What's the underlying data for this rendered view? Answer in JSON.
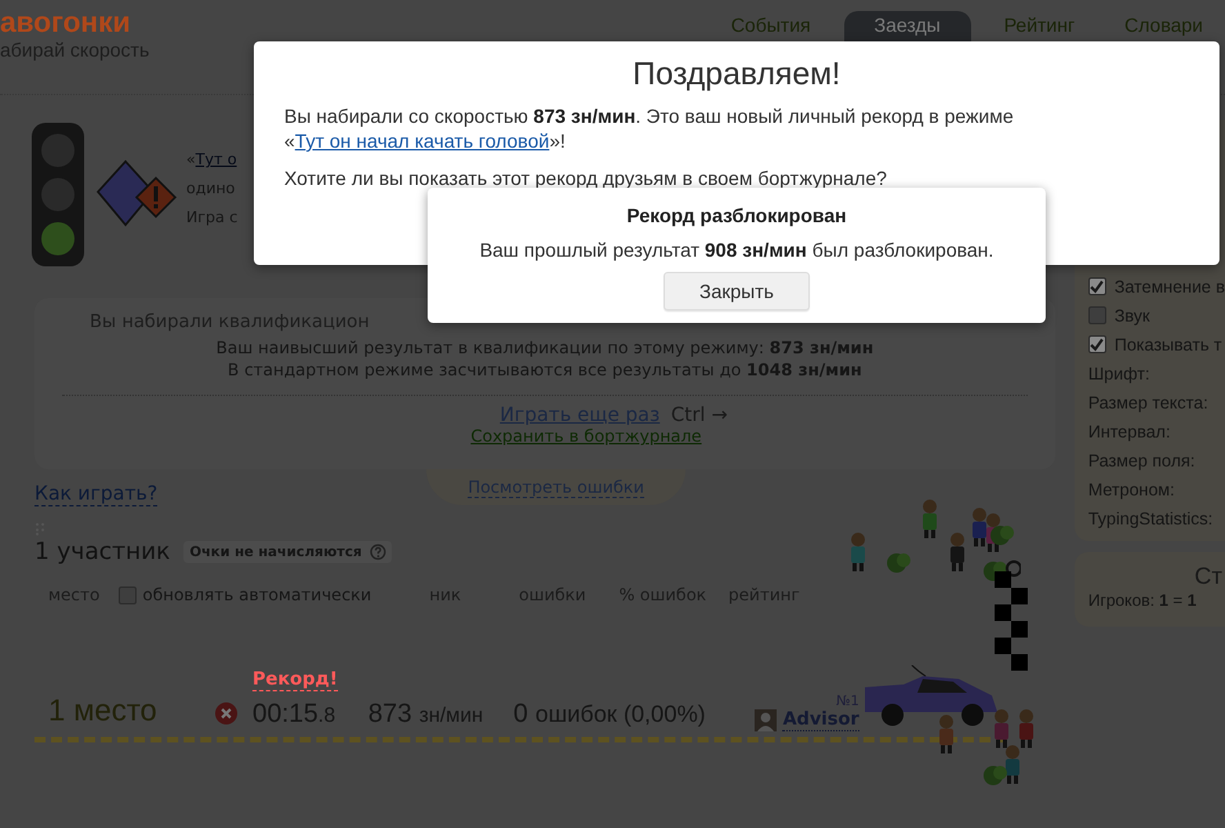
{
  "header": {
    "logo": "авогонки",
    "slogan": "абирай скорость",
    "tabs": [
      {
        "label": "События",
        "selected": false
      },
      {
        "label": "Заезды",
        "selected": true
      },
      {
        "label": "Рейтинг",
        "selected": false
      },
      {
        "label": "Словари",
        "selected": false
      }
    ]
  },
  "game_info": {
    "quote": "«",
    "mode_link": "Тут о",
    "line_2": "одино",
    "line_3": "Игра с"
  },
  "result_panel": {
    "title": "Вы набирали квалификацион",
    "lines": [
      "Ваш наивысший результат в квалификации по этому режиму: **873 зн/мин**",
      "В стандартном режиме засчитываются все результаты до **1048 зн/мин**"
    ],
    "play_again": "Играть еще раз",
    "shortcut": "Ctrl →",
    "save_link": "Сохранить в бортжурнале"
  },
  "how_to_play": "Как играть?",
  "errors_tab": "Посмотреть ошибки",
  "participants": {
    "title": "1 участник",
    "badge": "Очки не начисляются",
    "columns": [
      {
        "kind": "text",
        "label": "место"
      },
      {
        "kind": "checkbox",
        "label": "обновлять автоматически",
        "checked": false
      },
      {
        "kind": "text",
        "label": "ник"
      },
      {
        "kind": "text",
        "label": "ошибки"
      },
      {
        "kind": "text",
        "label": "% ошибок"
      },
      {
        "kind": "text",
        "label": "рейтинг"
      }
    ],
    "rows": [
      {
        "record": "Рекорд!",
        "place": "1 место",
        "time": "00:15.8",
        "speed": "873",
        "speed_unit": "зн/мин",
        "errors": "0",
        "errors_text": "ошибок (0,00%)",
        "number": "№1",
        "nick": "Advisor"
      }
    ]
  },
  "sidebar": {
    "options": [
      {
        "kind": "checkbox",
        "label": "Затемнение в",
        "checked": true
      },
      {
        "kind": "checkbox",
        "label": "Звук",
        "checked": false
      },
      {
        "kind": "checkbox",
        "label": "Показывать т",
        "checked": true
      },
      {
        "kind": "setting",
        "label": "Шрифт:"
      },
      {
        "kind": "setting",
        "label": "Размер текста:"
      },
      {
        "kind": "setting",
        "label": "Интервал:"
      },
      {
        "kind": "setting",
        "label": "Размер поля:"
      },
      {
        "kind": "setting",
        "label": "Метроном:"
      },
      {
        "kind": "setting",
        "label": "TypingStatistics:"
      }
    ],
    "stats": {
      "title": "Ст",
      "players": "Игроков: **1** = **1**"
    }
  },
  "congrats_dialog": {
    "title": "Поздравляем!",
    "text_before": "Вы набирали со скоростью **873 зн/мин**. Это ваш новый личный рекорд в режиме «",
    "mode_link": "Тут он начал качать головой",
    "text_after": "»!",
    "question": "Хотите ли вы показать этот рекорд друзьям в своем бортжурнале?"
  },
  "unlock_dialog": {
    "title": "Рекорд разблокирован",
    "text": "Ваш прошлый результат **908 зн/мин** был разблокирован.",
    "button": "Закрыть"
  }
}
